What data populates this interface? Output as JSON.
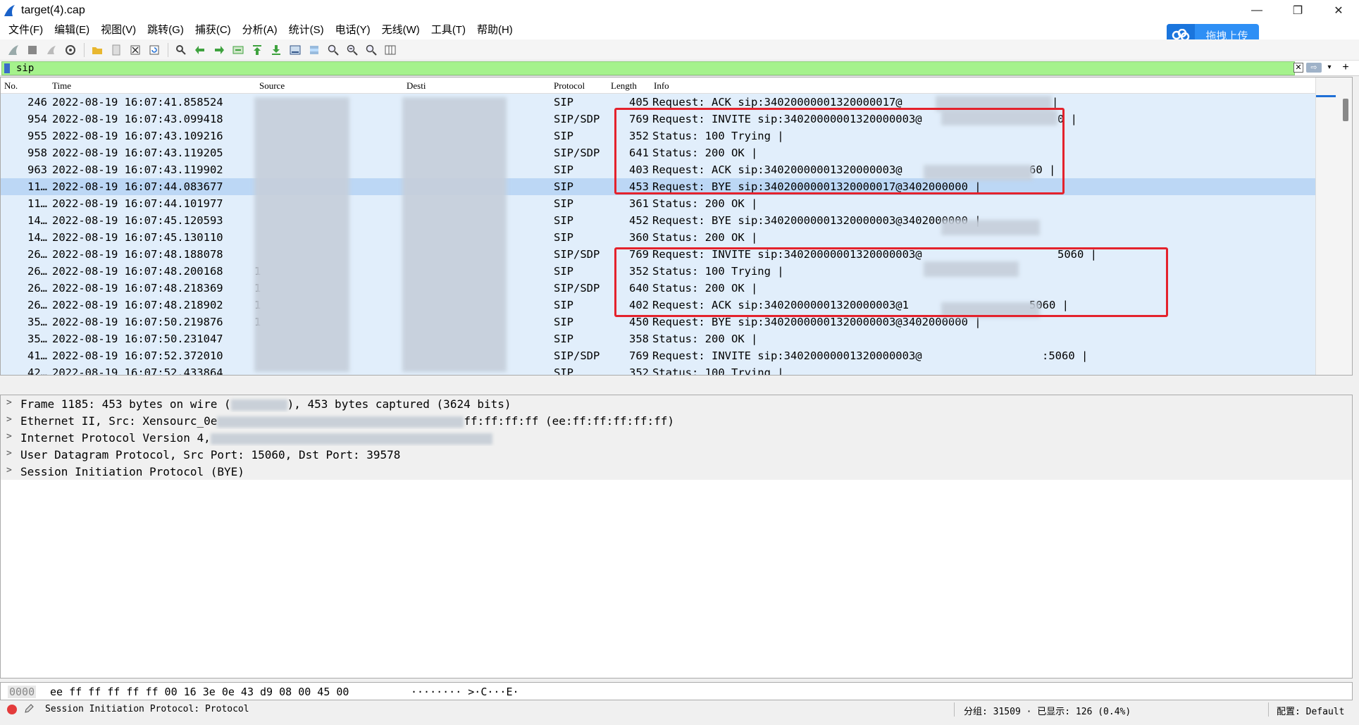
{
  "window": {
    "title": "target(4).cap",
    "minimize": "—",
    "restore": "❐",
    "close": "✕"
  },
  "menu": [
    "文件(F)",
    "编辑(E)",
    "视图(V)",
    "跳转(G)",
    "捕获(C)",
    "分析(A)",
    "统计(S)",
    "电话(Y)",
    "无线(W)",
    "工具(T)",
    "帮助(H)"
  ],
  "upload_button": "拖拽上传",
  "filter": {
    "value": "sip",
    "clear": "✕",
    "apply": "⇨",
    "dropdown": "▾",
    "add": "+"
  },
  "columns": {
    "no": "No.",
    "time": "Time",
    "source": "Source",
    "destination": "Desti",
    "protocol": "Protocol",
    "length": "Length",
    "info": "Info"
  },
  "packets": [
    {
      "no": "246",
      "time": "2022-08-19 16:07:41.858524",
      "source": "",
      "destination": "",
      "protocol": "SIP",
      "length": "405",
      "info": "Request: ACK sip:34020000001320000017@",
      "info_tail": "|"
    },
    {
      "no": "954",
      "time": "2022-08-19 16:07:43.099418",
      "source": "",
      "destination": "",
      "protocol": "SIP/SDP",
      "length": "769",
      "info": "Request: INVITE sip:34020000001320000003@",
      "info_tail": "0  |"
    },
    {
      "no": "955",
      "time": "2022-08-19 16:07:43.109216",
      "source": "",
      "destination": "",
      "protocol": "SIP",
      "length": "352",
      "info": "Status: 100 Trying |",
      "info_tail": ""
    },
    {
      "no": "958",
      "time": "2022-08-19 16:07:43.119205",
      "source": "",
      "destination": "",
      "protocol": "SIP/SDP",
      "length": "641",
      "info": "Status: 200 OK |",
      "info_tail": ""
    },
    {
      "no": "963",
      "time": "2022-08-19 16:07:43.119902",
      "source": "",
      "destination": "",
      "protocol": "SIP",
      "length": "403",
      "info": "Request: ACK sip:34020000001320000003@",
      "info_tail": "60 |"
    },
    {
      "no": "11…",
      "time": "2022-08-19 16:07:44.083677",
      "source": "",
      "destination": "",
      "protocol": "SIP",
      "length": "453",
      "info": "Request: BYE sip:34020000001320000017@3402000000 |",
      "info_tail": "",
      "selected": true
    },
    {
      "no": "11…",
      "time": "2022-08-19 16:07:44.101977",
      "source": "",
      "destination": "",
      "protocol": "SIP",
      "length": "361",
      "info": "Status: 200 OK |",
      "info_tail": ""
    },
    {
      "no": "14…",
      "time": "2022-08-19 16:07:45.120593",
      "source": "",
      "destination": "",
      "protocol": "SIP",
      "length": "452",
      "info": "Request: BYE sip:34020000001320000003@3402000000 |",
      "info_tail": ""
    },
    {
      "no": "14…",
      "time": "2022-08-19 16:07:45.130110",
      "source": "",
      "destination": "",
      "protocol": "SIP",
      "length": "360",
      "info": "Status: 200 OK |",
      "info_tail": ""
    },
    {
      "no": "26…",
      "time": "2022-08-19 16:07:48.188078",
      "source": "",
      "destination": "",
      "protocol": "SIP/SDP",
      "length": "769",
      "info": "Request: INVITE sip:34020000001320000003@",
      "info_tail": "5060 |"
    },
    {
      "no": "26…",
      "time": "2022-08-19 16:07:48.200168",
      "source": "1",
      "destination": "",
      "protocol": "SIP",
      "length": "352",
      "info": "Status: 100 Trying |",
      "info_tail": ""
    },
    {
      "no": "26…",
      "time": "2022-08-19 16:07:48.218369",
      "source": "1",
      "destination": "",
      "protocol": "SIP/SDP",
      "length": "640",
      "info": "Status: 200 OK |",
      "info_tail": ""
    },
    {
      "no": "26…",
      "time": "2022-08-19 16:07:48.218902",
      "source": "1",
      "destination": "",
      "protocol": "SIP",
      "length": "402",
      "info": "Request: ACK sip:34020000001320000003@1",
      "info_tail": "5060 |"
    },
    {
      "no": "35…",
      "time": "2022-08-19 16:07:50.219876",
      "source": "1",
      "destination": "",
      "protocol": "SIP",
      "length": "450",
      "info": "Request: BYE sip:34020000001320000003@3402000000 |",
      "info_tail": ""
    },
    {
      "no": "35…",
      "time": "2022-08-19 16:07:50.231047",
      "source": "",
      "destination": "",
      "protocol": "SIP",
      "length": "358",
      "info": "Status: 200 OK |",
      "info_tail": ""
    },
    {
      "no": "41…",
      "time": "2022-08-19 16:07:52.372010",
      "source": "",
      "destination": "",
      "protocol": "SIP/SDP",
      "length": "769",
      "info": "Request: INVITE sip:34020000001320000003@",
      "info_tail": ":5060 |"
    },
    {
      "no": "42…",
      "time": "2022-08-19 16:07:52.433864",
      "source": "",
      "destination": "",
      "protocol": "SIP",
      "length": "352",
      "info": "Status: 100 Trying |",
      "info_tail": ""
    }
  ],
  "details": [
    "Frame 1185: 453 bytes on wire (",
    "Ethernet II, Src: Xensourc_0e",
    "Internet Protocol Version 4,",
    "User Datagram Protocol, Src Port: 15060, Dst Port: 39578",
    "Session Initiation Protocol (BYE)"
  ],
  "details_tails": [
    "), 453 bytes captured (3624 bits)",
    "ff:ff:ff:ff (ee:ff:ff:ff:ff:ff)",
    "",
    "",
    ""
  ],
  "bytes": {
    "offset": "0000",
    "hex": "ee ff ff ff ff ff 00 16  3e 0e 43 d9 08 00 45 00",
    "ascii": "········ >·C···E·"
  },
  "status": {
    "message": "Session Initiation Protocol: Protocol",
    "packets": "分组: 31509 · 已显示: 126 (0.4%)",
    "profile": "配置: Default"
  },
  "colors": {
    "filter_valid": "#a5f28c",
    "row_bg": "#e1eefb",
    "row_selected": "#bcd7f5",
    "highlight_box": "#e4222c"
  }
}
